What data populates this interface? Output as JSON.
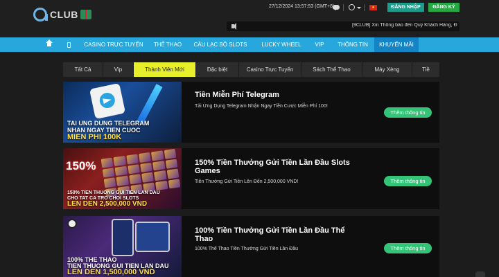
{
  "header": {
    "logo_text": "CLUB",
    "datetime": "27/12/2024 13:57:53 (GMT+8)",
    "flag_star": "★",
    "login_label": "ĐĂNG NHẬP",
    "register_label": "ĐĂNG KÝ",
    "marquee_text": "[9CLUB] Xin Thông báo đến Quý Khách Hàng, Đ"
  },
  "nav": {
    "items": [
      "CASINO TRỰC TUYẾN",
      "THỂ THAO",
      "CÂU LẠC BỘ SLOTS",
      "LUCKY WHEEL",
      "VIP",
      "THÔNG TIN",
      "KHUYẾN MÃI"
    ],
    "active_index": 6
  },
  "categories": {
    "items": [
      "Tất Cả",
      "Vip",
      "Thành Viên Mới",
      "Đặc biệt",
      "Casino Trực Tuyến",
      "Sách Thể Thao",
      "Máy Xèng",
      "Tiề"
    ],
    "active_index": 2
  },
  "promotions": [
    {
      "title": "Tiền Miễn Phí Telegram",
      "description": "Tải Ứng Dụng Telegram Nhận Ngay Tiền Cược Miễn Phí 100!",
      "button_label": "Thêm thông tin",
      "image_lines": [
        "TAI UNG DUNG TELEGRAM",
        "NHAN NGAY TIEN CUOC",
        "MIEN PHI 100K"
      ]
    },
    {
      "title": "150% Tiền Thưởng Gửi Tiền Lần Đầu Slots Games",
      "description": "Tiền Thưởng Gửi Tiền Lên Đến 2,500,000 VND!",
      "button_label": "Thêm thông tin",
      "image_badge": "150%",
      "image_lines": [
        "150% TIEN THUONG GUI TIEN LAN DAU",
        "CHO TAT CA TRO CHOI SLOTS",
        "LEN DEN 2,500,000 VND"
      ]
    },
    {
      "title": "100% Tiền Thưởng Gửi Tiền Lần Đầu Thể Thao",
      "description": "100% Thể Thao Tiền Thưởng Gửi Tiền Lần Đầu",
      "button_label": "Thêm thông tin",
      "image_lines": [
        "100% THE THAO",
        "TIEN THUONG GUI TIEN LAN DAU",
        "LEN DEN 1,500,000 VND"
      ]
    }
  ],
  "colors": {
    "nav_bg": "#27a7dc",
    "nav_active": "#1584c4",
    "category_active": "#e6ef2a",
    "more_button": "#33c477",
    "login_button": "#1d9c8c",
    "register_button": "#28a745"
  },
  "icons": [
    "home-icon",
    "phone-icon",
    "chat-icon",
    "circle-icon",
    "caret-icon",
    "flag-icon",
    "speaker-icon",
    "telegram-icon",
    "scroll-top-icon"
  ]
}
